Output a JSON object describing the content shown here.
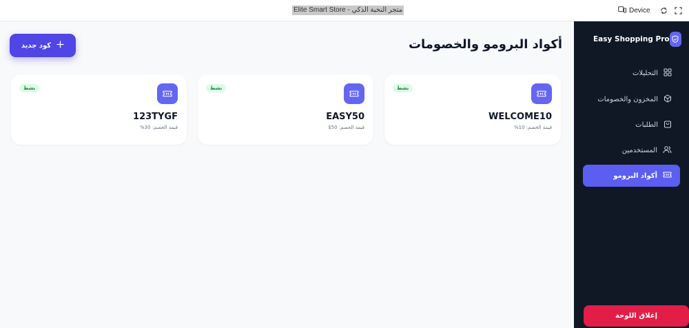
{
  "window": {
    "title": "Elite Smart Store - متجر النخبة الذكي",
    "device_label": "Device"
  },
  "sidebar": {
    "brand": "Easy Shopping Pro",
    "items": [
      {
        "label": "التحليلات",
        "icon": "grid-icon",
        "active": false
      },
      {
        "label": "المخزون والخصومات",
        "icon": "box-icon",
        "active": false
      },
      {
        "label": "الطلبات",
        "icon": "shopping-bag-icon",
        "active": false
      },
      {
        "label": "المستخدمين",
        "icon": "users-icon",
        "active": false
      },
      {
        "label": "أكواد البرومو",
        "icon": "ticket-icon",
        "active": true
      }
    ],
    "close_label": "إغلاق اللوحة"
  },
  "main": {
    "title": "أكواد البرومو والخصومات",
    "new_button_label": "كود جديد",
    "promo_codes": [
      {
        "code": "WELCOME10",
        "discount": "قيمة الخصم: 10%",
        "status": "نشط"
      },
      {
        "code": "EASY50",
        "discount": "قيمة الخصم: 50$",
        "status": "نشط"
      },
      {
        "code": "123TYGF",
        "discount": "قيمة الخصم: 30%",
        "status": "نشط"
      }
    ]
  },
  "colors": {
    "sidebar_bg": "#101826",
    "accent": "#5b5ef0",
    "danger": "#e11d48",
    "active_badge_bg": "#dcfce7",
    "active_badge_text": "#15803d"
  }
}
